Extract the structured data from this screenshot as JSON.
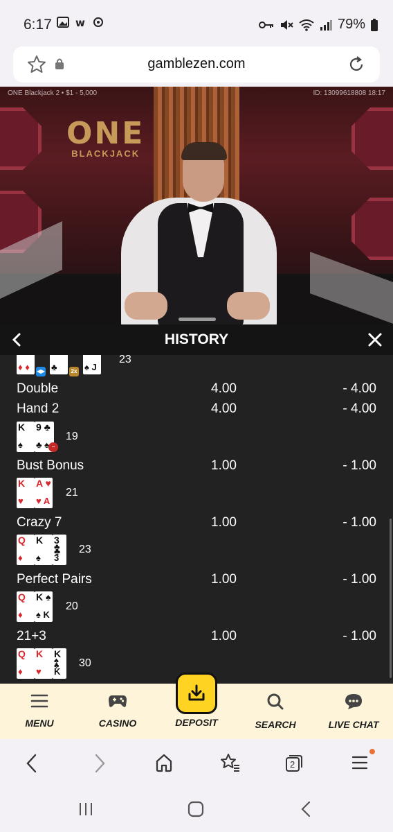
{
  "status": {
    "time": "6:17",
    "battery": "79%",
    "left_icons": [
      "image-icon",
      "w-icon",
      "signal-boost-icon"
    ],
    "right_icons": [
      "key-icon",
      "mute-icon",
      "wifi-icon",
      "signal-icon",
      "battery-icon"
    ]
  },
  "browser": {
    "url": "gamblezen.com",
    "tab_count": "2"
  },
  "video": {
    "game_info": "ONE Blackjack 2 • $1 - 5,000",
    "round_id": "ID: 13099618808 18:17",
    "logo_one": "ONE",
    "logo_sub": "BLACKJACK"
  },
  "history": {
    "title": "HISTORY",
    "top_hand_total": "23",
    "rows": [
      {
        "label": "Double",
        "stake": "4.00",
        "result": "- 4.00"
      },
      {
        "label": "Hand 2",
        "stake": "4.00",
        "result": "- 4.00"
      },
      {
        "label": "Bust Bonus",
        "stake": "1.00",
        "result": "- 1.00"
      },
      {
        "label": "Crazy 7",
        "stake": "1.00",
        "result": "- 1.00"
      },
      {
        "label": "Perfect Pairs",
        "stake": "1.00",
        "result": "- 1.00"
      },
      {
        "label": "21+3",
        "stake": "1.00",
        "result": "- 1.00"
      }
    ],
    "hands": [
      {
        "total": "19",
        "cards": [
          {
            "rank": "K",
            "color": "black"
          },
          {
            "rank": "9",
            "color": "black"
          }
        ]
      },
      {
        "total": "21",
        "cards": [
          {
            "rank": "K",
            "color": "red"
          },
          {
            "rank": "A",
            "color": "red"
          }
        ]
      },
      {
        "total": "23",
        "cards": [
          {
            "rank": "Q",
            "color": "red"
          },
          {
            "rank": "K",
            "color": "black"
          },
          {
            "rank": "3",
            "color": "black"
          }
        ]
      },
      {
        "total": "20",
        "cards": [
          {
            "rank": "Q",
            "color": "red"
          },
          {
            "rank": "K",
            "color": "black"
          }
        ]
      },
      {
        "total": "30",
        "cards": [
          {
            "rank": "Q",
            "color": "red"
          },
          {
            "rank": "K",
            "color": "red"
          },
          {
            "rank": "K",
            "color": "black"
          }
        ]
      }
    ],
    "badges": {
      "split": "◀▶",
      "double": "2x"
    }
  },
  "bottom_nav": {
    "menu": "MENU",
    "casino": "CASINO",
    "deposit": "DEPOSIT",
    "search": "SEARCH",
    "live_chat": "LIVE CHAT"
  },
  "colors": {
    "accent": "#ffd322",
    "nav_bg": "#fdf4d9",
    "card_red": "#d9262c",
    "history_bg": "#222222"
  }
}
